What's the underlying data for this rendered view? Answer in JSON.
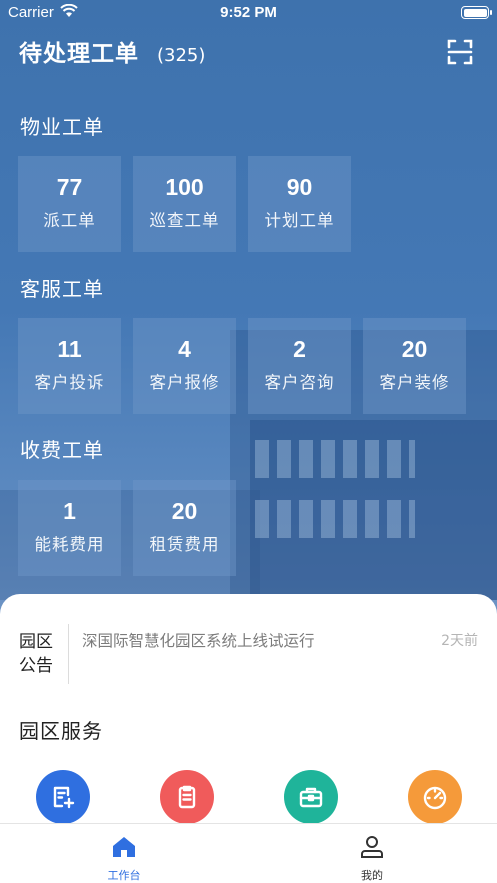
{
  "status_bar": {
    "carrier": "Carrier",
    "time": "9:52 PM"
  },
  "header": {
    "title": "待处理工单",
    "count": "(325)"
  },
  "sections": [
    {
      "title": "物业工单",
      "tiles": [
        {
          "value": "77",
          "label": "派工单"
        },
        {
          "value": "100",
          "label": "巡查工单"
        },
        {
          "value": "90",
          "label": "计划工单"
        }
      ]
    },
    {
      "title": "客服工单",
      "tiles": [
        {
          "value": "11",
          "label": "客户投诉"
        },
        {
          "value": "4",
          "label": "客户报修"
        },
        {
          "value": "2",
          "label": "客户咨询"
        },
        {
          "value": "20",
          "label": "客户装修"
        }
      ]
    },
    {
      "title": "收费工单",
      "tiles": [
        {
          "value": "1",
          "label": "能耗费用"
        },
        {
          "value": "20",
          "label": "租赁费用"
        }
      ]
    }
  ],
  "notice": {
    "label": "园区公告",
    "text": "深国际智慧化园区系统上线试运行",
    "time": "2天前"
  },
  "services": {
    "title": "园区服务",
    "items": [
      {
        "icon": "add-document-icon",
        "color": "#2f6fe0"
      },
      {
        "icon": "clipboard-icon",
        "color": "#f05b5b"
      },
      {
        "icon": "briefcase-icon",
        "color": "#1fb49a"
      },
      {
        "icon": "gauge-icon",
        "color": "#f59a3a"
      }
    ]
  },
  "tabbar": {
    "items": [
      {
        "label": "工作台",
        "icon": "home-icon",
        "active": true
      },
      {
        "label": "我的",
        "icon": "user-icon",
        "active": false
      }
    ],
    "active_color": "#2f6fe0",
    "inactive_color": "#333333"
  }
}
